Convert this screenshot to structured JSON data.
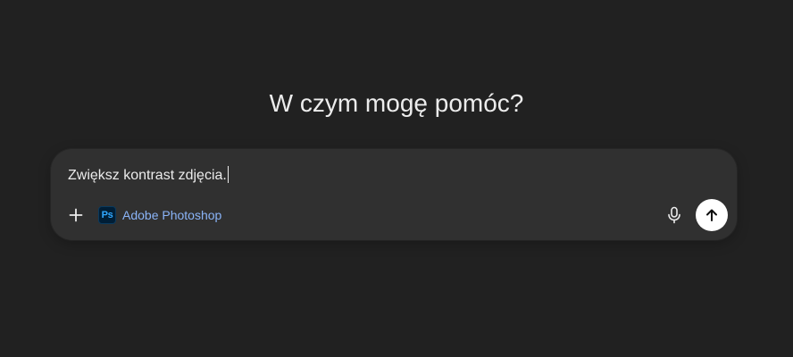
{
  "heading": "W czym mogę pomóc?",
  "composer": {
    "input_value": "Zwiększ kontrast zdjęcia.",
    "tool": {
      "logo_text": "Ps",
      "label": "Adobe Photoshop"
    },
    "icons": {
      "add": "plus-icon",
      "mic": "microphone-icon",
      "send": "arrow-up-icon"
    }
  },
  "colors": {
    "background": "#212121",
    "composer": "#303030",
    "tool_label": "#8ab4f8",
    "ps_logo_bg": "#001e36",
    "ps_logo_text": "#31a8ff",
    "send_button": "#ffffff"
  }
}
